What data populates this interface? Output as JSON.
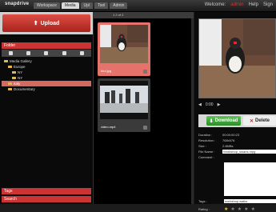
{
  "topbar": {
    "logo": "snapdrive",
    "tabs": [
      "Workspace",
      "Media",
      "Upl",
      "Tool",
      "Admin"
    ],
    "welcome": "Welcome:",
    "user": "admin",
    "help": "Help",
    "signout": "Sign"
  },
  "left": {
    "upload_label": "Upload",
    "folders_label": "Folder",
    "tree": [
      {
        "label": "Media Gallery",
        "indent": 1,
        "selected": false
      },
      {
        "label": "Europe",
        "indent": 2,
        "selected": false
      },
      {
        "label": "NY",
        "indent": 3,
        "selected": false
      },
      {
        "label": "NY",
        "indent": 3,
        "selected": false
      },
      {
        "label": "Italy",
        "indent": 2,
        "selected": true
      },
      {
        "label": "Documentary",
        "indent": 2,
        "selected": false
      }
    ],
    "tags_label": "Tags",
    "search_label": "Search"
  },
  "middle": {
    "header": "1 2 of 2",
    "cards": [
      {
        "caption": "bird.jpg",
        "selected": true
      },
      {
        "caption": "video.mp4",
        "selected": false
      }
    ]
  },
  "right": {
    "download_label": "Download",
    "delete_label": "Delete",
    "controls": {
      "time": "0:00"
    },
    "meta": [
      {
        "k": "Duration :",
        "v": "00:00:00:23"
      },
      {
        "k": "Resolution :",
        "v": "768x576"
      },
      {
        "k": "Size :",
        "v": "2.8MBs"
      }
    ],
    "filename_label": "File Name :",
    "filename_value": "Workshop_swans.mpg",
    "comment_label": "Comment :",
    "tags_label": "Tags :",
    "tags_value": "workshop,walks",
    "rating_label": "Rating :"
  },
  "icons": [
    "upload-icon",
    "folder-icon",
    "download-icon",
    "delete-icon",
    "star-icon",
    "play-icon",
    "rewind-icon"
  ]
}
